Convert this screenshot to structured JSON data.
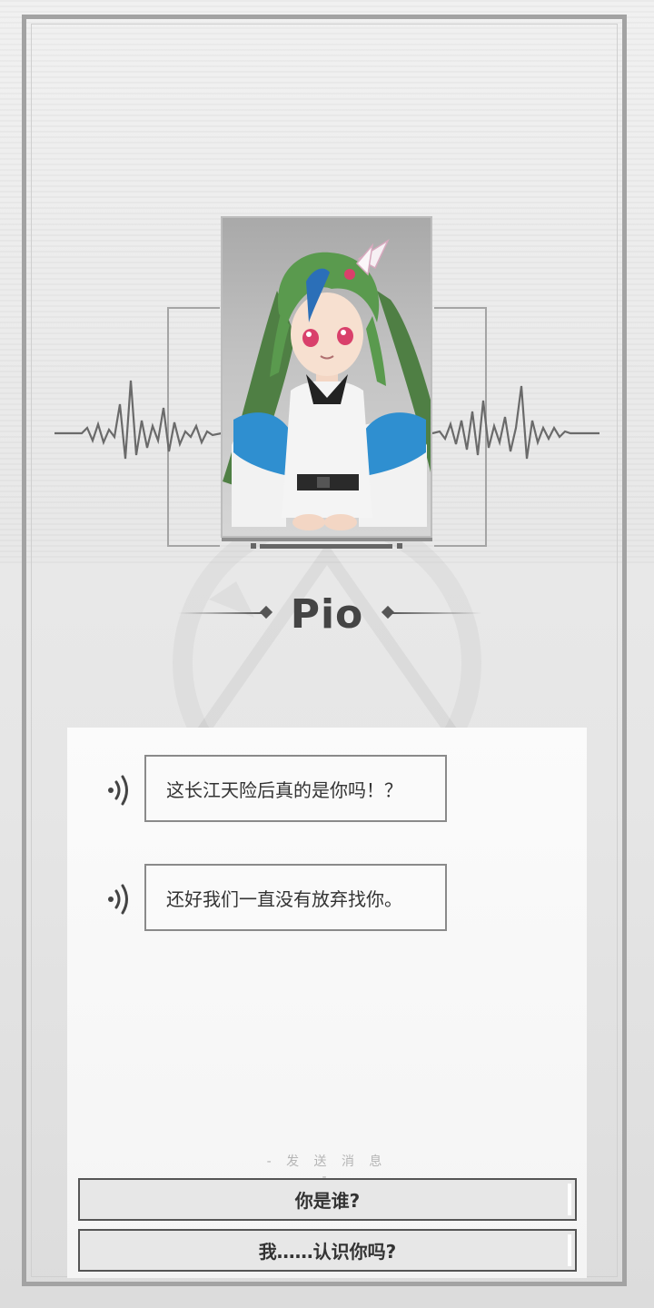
{
  "contact": {
    "name": "Pio"
  },
  "messages": [
    {
      "text": "这长江天险后真的是你吗！？"
    },
    {
      "text": "还好我们一直没有放弃找你。"
    }
  ],
  "reply": {
    "label": "- 发 送 消 息 -",
    "options": [
      {
        "text": "你是谁?"
      },
      {
        "text": "我……认识你吗?"
      }
    ]
  },
  "icons": {
    "message_voice": "speaker-wave-icon"
  }
}
